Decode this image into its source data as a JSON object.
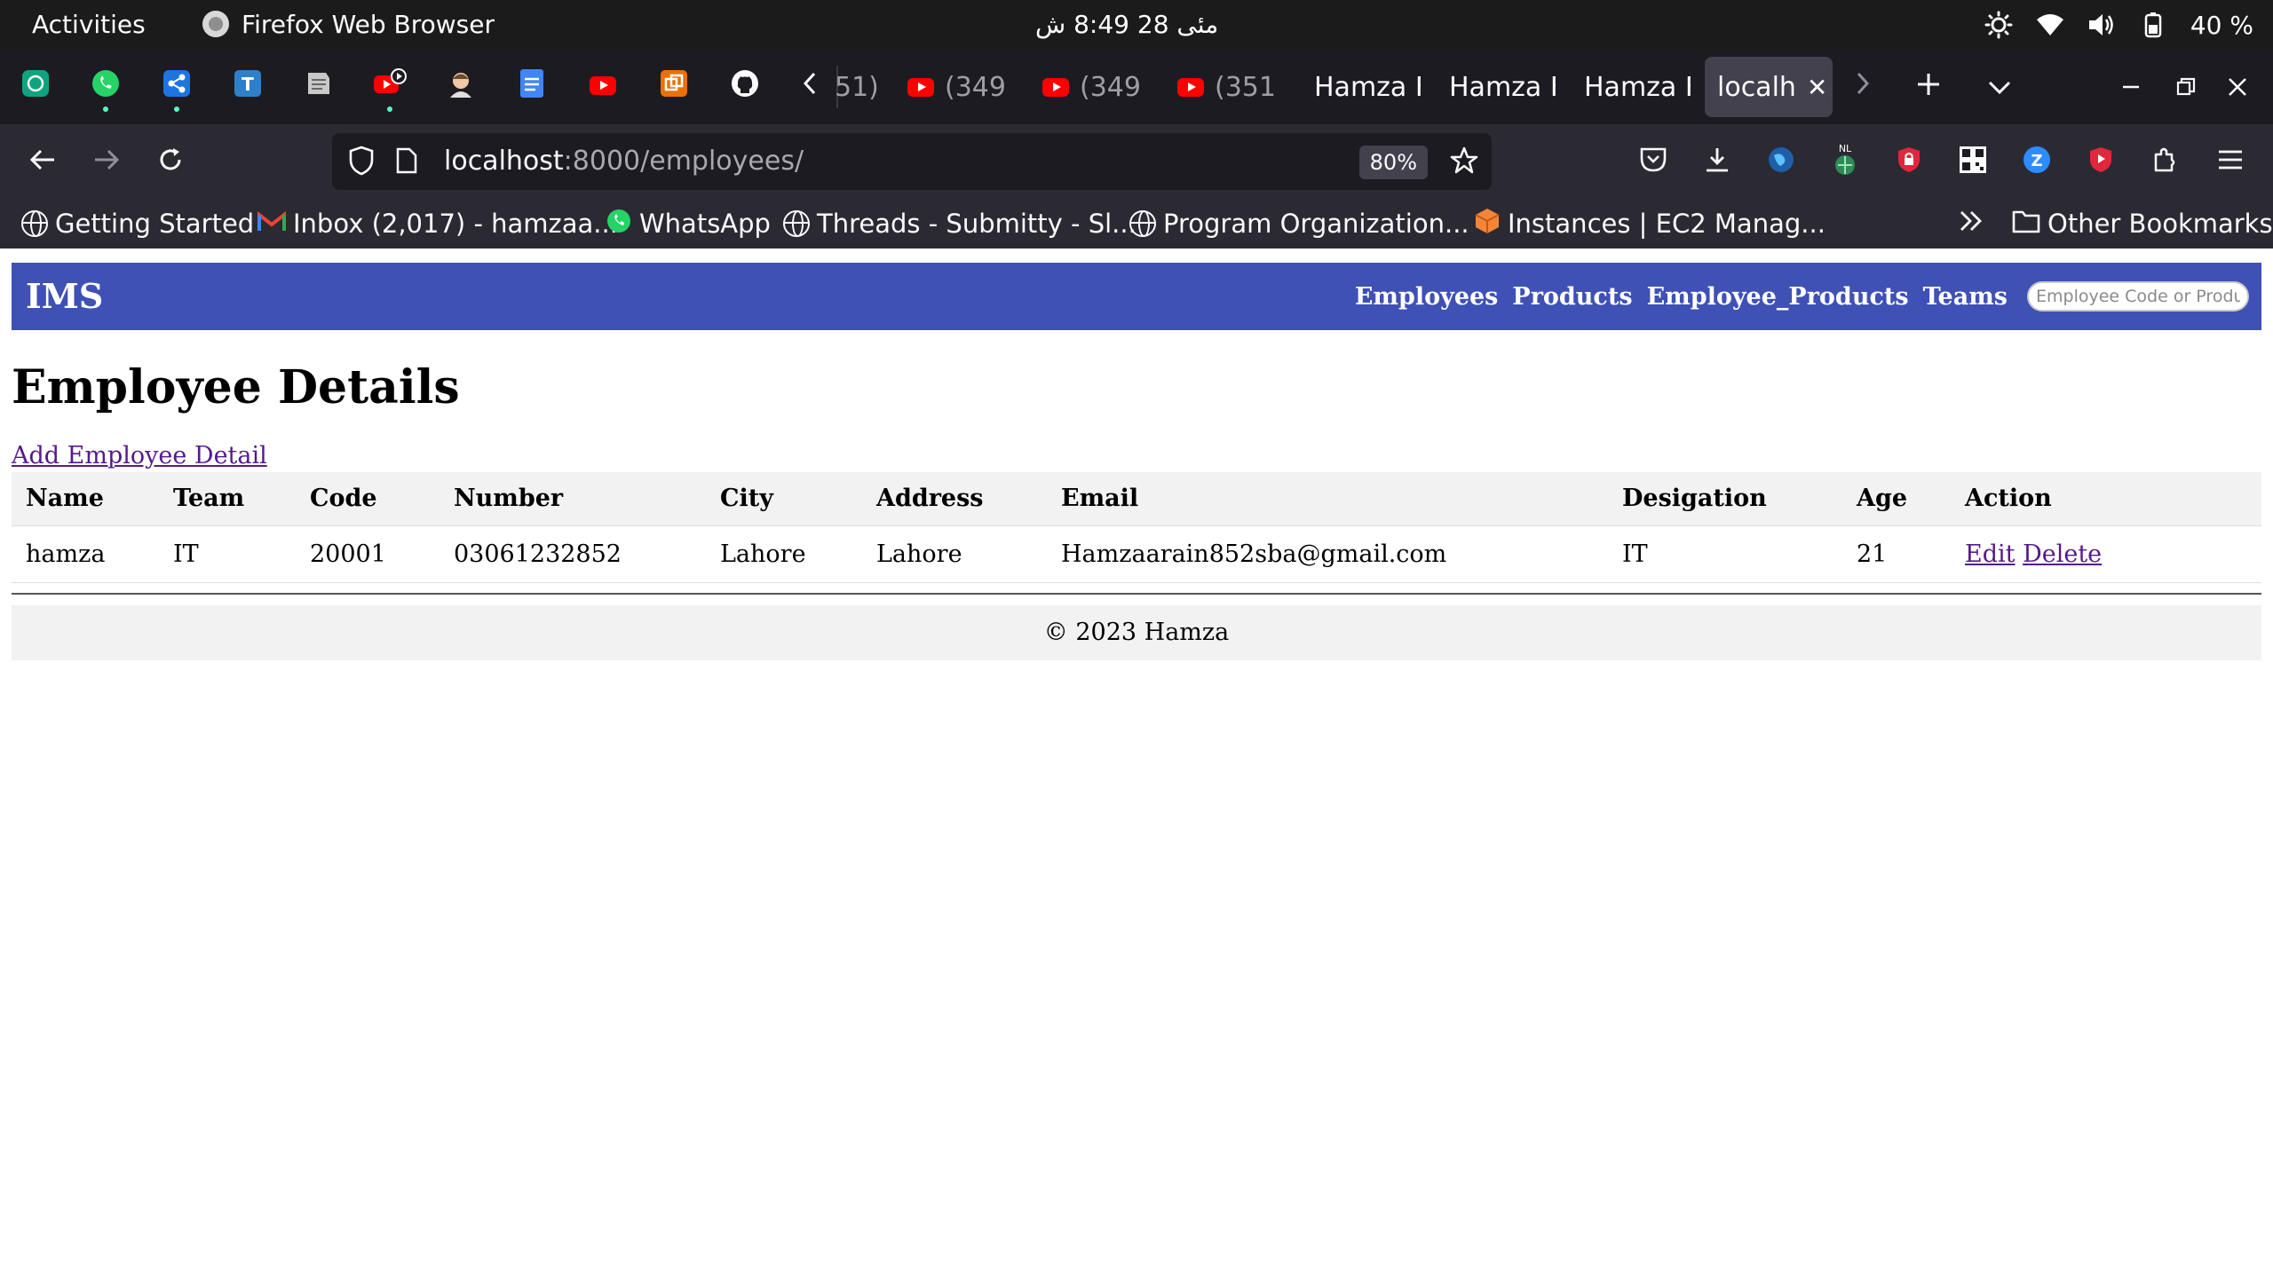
{
  "topbar": {
    "activities": "Activities",
    "app_name": "Firefox Web Browser",
    "clock": "مئی 28  8:49 ش",
    "battery": "40 %"
  },
  "tabs": {
    "tab1": "51)",
    "tab2": "(349",
    "tab3": "(349",
    "tab4": "(351",
    "tab5": "Hamza F",
    "tab6": "Hamza F",
    "tab7": "Hamza F",
    "active": "localh"
  },
  "navbar": {
    "url_host": "localhost",
    "url_path": ":8000/employees/",
    "zoom": "80%",
    "ext_badge": "NL"
  },
  "bookmarks": {
    "items": [
      "Getting Started",
      "Inbox (2,017) - hamzaa...",
      "WhatsApp",
      "Threads - Submitty - Sl...",
      "Program Organization...",
      "Instances | EC2 Manag..."
    ],
    "other": "Other Bookmarks"
  },
  "site": {
    "brand": "IMS",
    "nav": [
      "Employees",
      "Products",
      "Employee_Products",
      "Teams"
    ],
    "search_placeholder": "Employee Code or Product"
  },
  "content": {
    "title": "Employee Details",
    "add_link": "Add Employee Detail",
    "columns": [
      "Name",
      "Team",
      "Code",
      "Number",
      "City",
      "Address",
      "Email",
      "Desigation",
      "Age",
      "Action"
    ],
    "rows": [
      {
        "name": "hamza",
        "team": "IT",
        "code": "20001",
        "number": "03061232852",
        "city": "Lahore",
        "address": "Lahore",
        "email": "Hamzaarain852sba@gmail.com",
        "designation": "IT",
        "age": "21",
        "edit": "Edit",
        "delete": "Delete"
      }
    ],
    "footer": "© 2023 Hamza"
  },
  "colors": {
    "nav_bg": "#3f51b5",
    "link": "#551a8b",
    "chrome_dark": "#1c1b22",
    "chrome_mid": "#2b2a33"
  }
}
